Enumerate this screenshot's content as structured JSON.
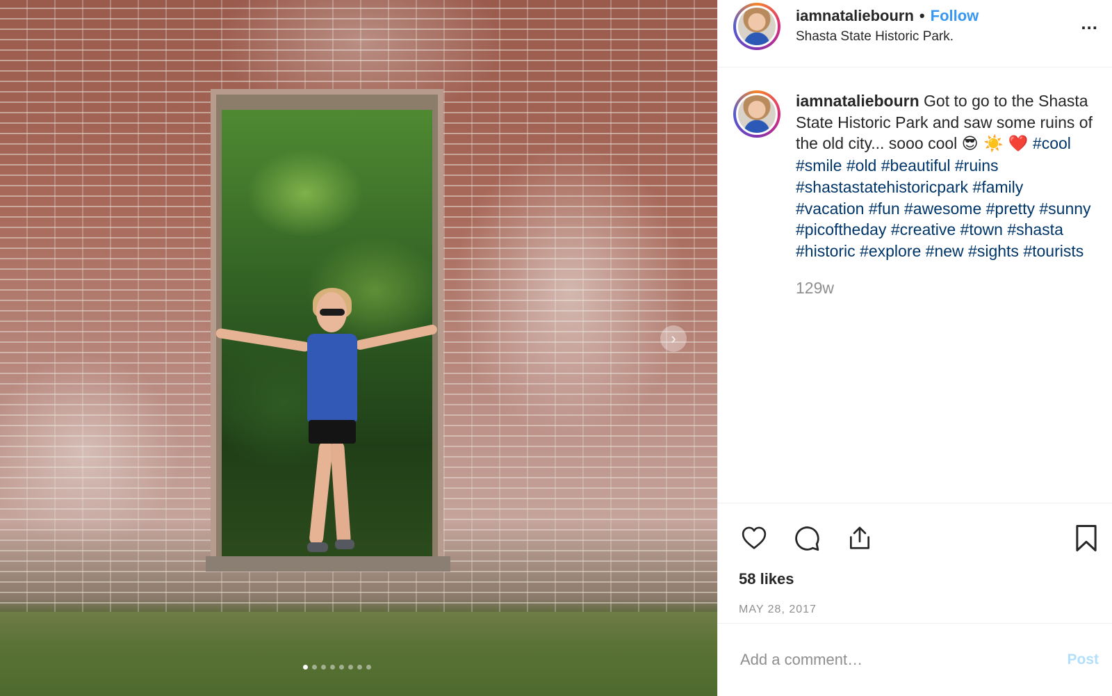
{
  "post": {
    "username": "iamnataliebourn",
    "separator": "•",
    "follow_label": "Follow",
    "location": "Shasta State Historic Park.",
    "more_label": "...",
    "caption_text": " Got to go to the Shasta State Historic Park and saw some ruins of the old city... sooo cool ",
    "caption_emojis": "😎 ☀️ ❤️",
    "hashtags": [
      "#cool",
      "#smile",
      "#old",
      "#beautiful",
      "#ruins",
      "#shastastatehistoricpark",
      "#family",
      "#vacation",
      "#fun",
      "#awesome",
      "#pretty",
      "#sunny",
      "#picoftheday",
      "#creative",
      "#town",
      "#shasta",
      "#historic",
      "#explore",
      "#new",
      "#sights",
      "#tourists"
    ],
    "time_ago": "129w",
    "likes": "58 likes",
    "date": "MAY 28, 2017"
  },
  "comment": {
    "placeholder": "Add a comment…",
    "post_label": "Post"
  },
  "carousel": {
    "slide_count": 8,
    "active_index": 0
  },
  "icons": {
    "like": "heart-icon",
    "comment": "comment-bubble-icon",
    "share": "share-icon",
    "save": "bookmark-icon",
    "next": "chevron-right-icon"
  },
  "colors": {
    "link": "#003569",
    "follow": "#3897f0",
    "muted": "#8e8e8e",
    "post_disabled": "#b2dffc"
  }
}
